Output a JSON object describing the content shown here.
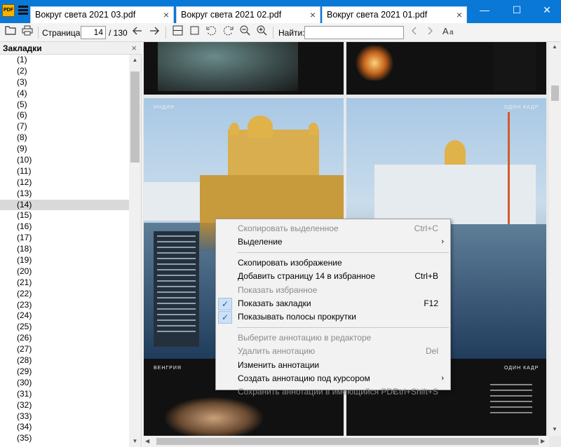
{
  "titlebar": {
    "tabs": [
      {
        "label": "Вокруг света 2021 03.pdf"
      },
      {
        "label": "Вокруг света 2021 02.pdf"
      },
      {
        "label": "Вокруг света 2021 01.pdf"
      }
    ],
    "tab_close": "×",
    "app_icon_text": "PDF",
    "minimize": "—",
    "maximize": "☐",
    "close": "✕"
  },
  "toolbar": {
    "page_label": "Страница:",
    "page_current": "14",
    "page_total": "/ 130",
    "find_label": "Найти:",
    "search_value": ""
  },
  "sidebar": {
    "title": "Закладки",
    "close": "×",
    "selected_index": 13,
    "items": [
      "(1)",
      "(2)",
      "(3)",
      "(4)",
      "(5)",
      "(6)",
      "(7)",
      "(8)",
      "(9)",
      "(10)",
      "(11)",
      "(12)",
      "(13)",
      "(14)",
      "(15)",
      "(16)",
      "(17)",
      "(18)",
      "(19)",
      "(20)",
      "(21)",
      "(22)",
      "(23)",
      "(24)",
      "(25)",
      "(26)",
      "(27)",
      "(28)",
      "(29)",
      "(30)",
      "(31)",
      "(32)",
      "(33)",
      "(34)",
      "(35)"
    ]
  },
  "document": {
    "page_labels": {
      "india": "ИНДИЯ",
      "odin_kadr_1": "ОДИН КАДР",
      "vengriya": "ВЕНГРИЯ",
      "odin_kadr_2": "ОДИН КАДР"
    }
  },
  "context_menu": {
    "items": [
      {
        "label": "Скопировать выделенное",
        "shortcut": "Ctrl+C",
        "disabled": true
      },
      {
        "label": "Выделение",
        "submenu": "›",
        "disabled": false
      },
      {
        "label": "Скопировать изображение",
        "disabled": false
      },
      {
        "label": "Добавить страницу 14 в избранное",
        "shortcut": "Ctrl+B",
        "disabled": false
      },
      {
        "label": "Показать избранное",
        "disabled": true
      },
      {
        "label": "Показать закладки",
        "shortcut": "F12",
        "checked": true,
        "disabled": false
      },
      {
        "label": "Показывать полосы прокрутки",
        "checked": true,
        "disabled": false
      },
      {
        "label": "Выберите аннотацию в редакторе",
        "disabled": true
      },
      {
        "label": "Удалить аннотацию",
        "shortcut": "Del",
        "disabled": true
      },
      {
        "label": "Изменить аннотации",
        "disabled": false
      },
      {
        "label": "Создать аннотацию под курсором",
        "submenu": "›",
        "disabled": false
      },
      {
        "label": "Сохранить аннотации в имеющийся PDF",
        "shortcut": "Ctrl+Shift+S",
        "disabled": true
      }
    ],
    "check_mark": "✓"
  },
  "icons": {
    "open": "folder-open-icon",
    "print": "printer-icon",
    "back": "arrow-left-icon",
    "forward": "arrow-right-icon",
    "fit_page": "fit-page-icon",
    "fit_width": "fit-width-icon",
    "rotate_left": "rotate-left-icon",
    "rotate_right": "rotate-right-icon",
    "zoom_out": "zoom-out-icon",
    "zoom_in": "zoom-in-icon",
    "find_prev": "chevron-left-icon",
    "find_next": "chevron-right-icon",
    "match_case": "match-case-icon"
  },
  "colors": {
    "titlebar": "#0a78d7",
    "menu_check_bg": "#cde0f5",
    "selection": "#d9d9d9"
  }
}
